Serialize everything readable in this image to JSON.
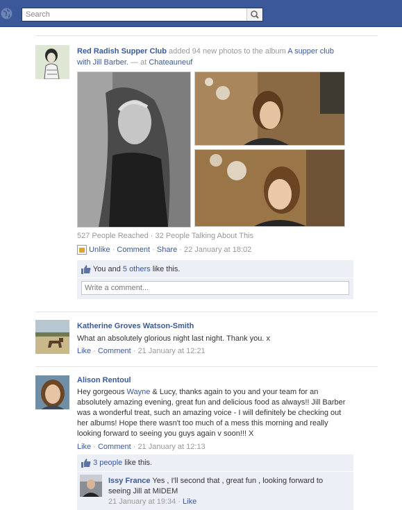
{
  "search": {
    "placeholder": "Search"
  },
  "post": {
    "author": "Red Radish Supper Club",
    "action1": " added 94 new photos to the album ",
    "album": "A supper club with Jill Barber.",
    "at": " — at ",
    "place": "Chateauneuf",
    "stats": "527 People Reached · 32 People Talking About This",
    "unlike": "Unlike",
    "comment": "Comment",
    "share": "Share",
    "time": "22 January at 18:02",
    "likes_prefix": "You and ",
    "likes_link": "5 others",
    "likes_suffix": " like this.",
    "comment_placeholder": "Write a comment..."
  },
  "comments": [
    {
      "author": "Katherine Groves Watson-Smith",
      "text": "What an absolutely glorious night last night. Thank you. x",
      "like": "Like",
      "comment": "Comment",
      "time": "21 January at 12:21"
    },
    {
      "author": "Alison Rentoul",
      "text_before": "Hey gorgeous ",
      "mention": "Wayne",
      "text_after": " & Lucy, thanks again to you and your team for an absolutely amazing evening, great fun and delicious food as always!! Jill Barber was a wonderful treat, such an amazing voice - I will definitely be checking out her albums! Hope there wasn't too much of a mess this morning and really looking forward to seeing you guys again v soon!!! X",
      "like": "Like",
      "comment": "Comment",
      "time": "21 January at 12:13",
      "likes_link": "3 people",
      "likes_suffix": " like this."
    }
  ],
  "reply": {
    "author": "Issy France",
    "text": " Yes , I'll second that , great fun , looking forward to seeing Jill at MIDEM",
    "time": "21 January at 19:34",
    "like": "Like"
  },
  "colors": {
    "header": "#3b5998",
    "link": "#3b5998",
    "ufi_bg": "#eceff5"
  }
}
